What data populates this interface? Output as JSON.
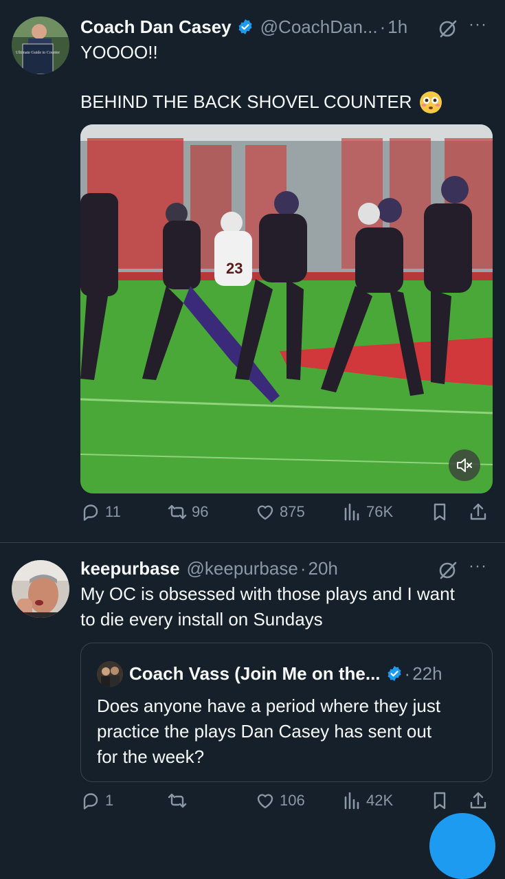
{
  "tweet1": {
    "author_name": "Coach Dan Casey",
    "handle": "@CoachDan...",
    "separator": "·",
    "time": "1h",
    "more": "···",
    "text_line1": "YOOOO!!",
    "text_line2": "BEHIND THE BACK SHOVEL COUNTER",
    "text_emoji": "flushed-face-emoji",
    "media": {
      "type": "video",
      "muted": true,
      "jersey_number": "23"
    },
    "avatar_book_text": "Ultimate Guide to Counter",
    "stats": {
      "replies": "11",
      "reposts": "96",
      "likes": "875",
      "views": "76K"
    }
  },
  "tweet2": {
    "author_name": "keepurbase",
    "handle": "@keepurbase",
    "separator": "·",
    "time": "20h",
    "more": "···",
    "text": "My OC is obsessed with those plays and I want\nto die every install on Sundays",
    "quote": {
      "author_name": "Coach Vass (Join Me on the...",
      "separator": "·",
      "time": "22h",
      "text": "Does anyone have a period where they just\npractice the plays Dan Casey has sent out\nfor the week?"
    },
    "stats": {
      "replies": "1",
      "reposts": "",
      "likes": "106",
      "views": "42K"
    }
  },
  "colors": {
    "background": "#15202b",
    "text": "#f7f9f9",
    "secondary": "#8b98a5",
    "verified": "#1d9bf0",
    "divider": "#38444d"
  }
}
